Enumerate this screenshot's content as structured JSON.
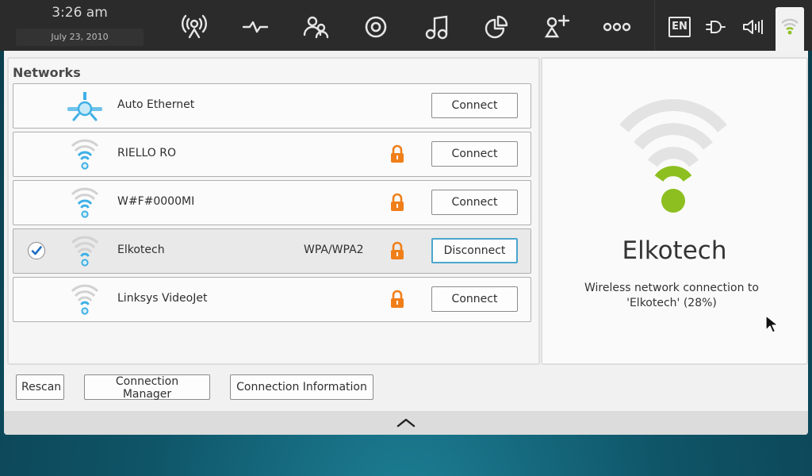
{
  "clock": {
    "time": "3:26 am",
    "date": "July 23, 2010"
  },
  "topbar": {
    "launcher_icons": [
      "broadcast-icon",
      "activity-icon",
      "contacts-icon",
      "media-disc-icon",
      "music-icon",
      "pie-chart-icon",
      "add-user-icon",
      "more-dots-icon"
    ],
    "tray": {
      "language": "EN",
      "tray_icons": [
        "power-plug-icon",
        "volume-icon",
        "wifi-signal-icon"
      ]
    }
  },
  "networks": {
    "heading": "Networks",
    "rows": [
      {
        "name": "Auto Ethernet",
        "type": "ethernet",
        "security": "",
        "locked": false,
        "connected": false,
        "button": "Connect"
      },
      {
        "name": "RIELLO RO",
        "type": "wifi",
        "security": "",
        "locked": true,
        "connected": false,
        "button": "Connect"
      },
      {
        "name": "W#F#0000MI",
        "type": "wifi",
        "security": "",
        "locked": true,
        "connected": false,
        "button": "Connect"
      },
      {
        "name": "Elkotech",
        "type": "wifi",
        "security": "WPA/WPA2",
        "locked": true,
        "connected": true,
        "button": "Disconnect"
      },
      {
        "name": "Linksys VideoJet",
        "type": "wifi",
        "security": "",
        "locked": true,
        "connected": false,
        "button": "Connect"
      }
    ]
  },
  "details": {
    "name": "Elkotech",
    "description": "Wireless network connection to 'Elkotech' (28%)",
    "signal_percent": 28
  },
  "actions": {
    "rescan": "Rescan",
    "connection_manager": "Connection Manager",
    "connection_information": "Connection Information"
  },
  "colors": {
    "accent_blue": "#3fb0e6",
    "signal_green": "#8cbf1f",
    "lock_orange": "#f07f1a",
    "topbar_bg": "#2b2b2b"
  }
}
